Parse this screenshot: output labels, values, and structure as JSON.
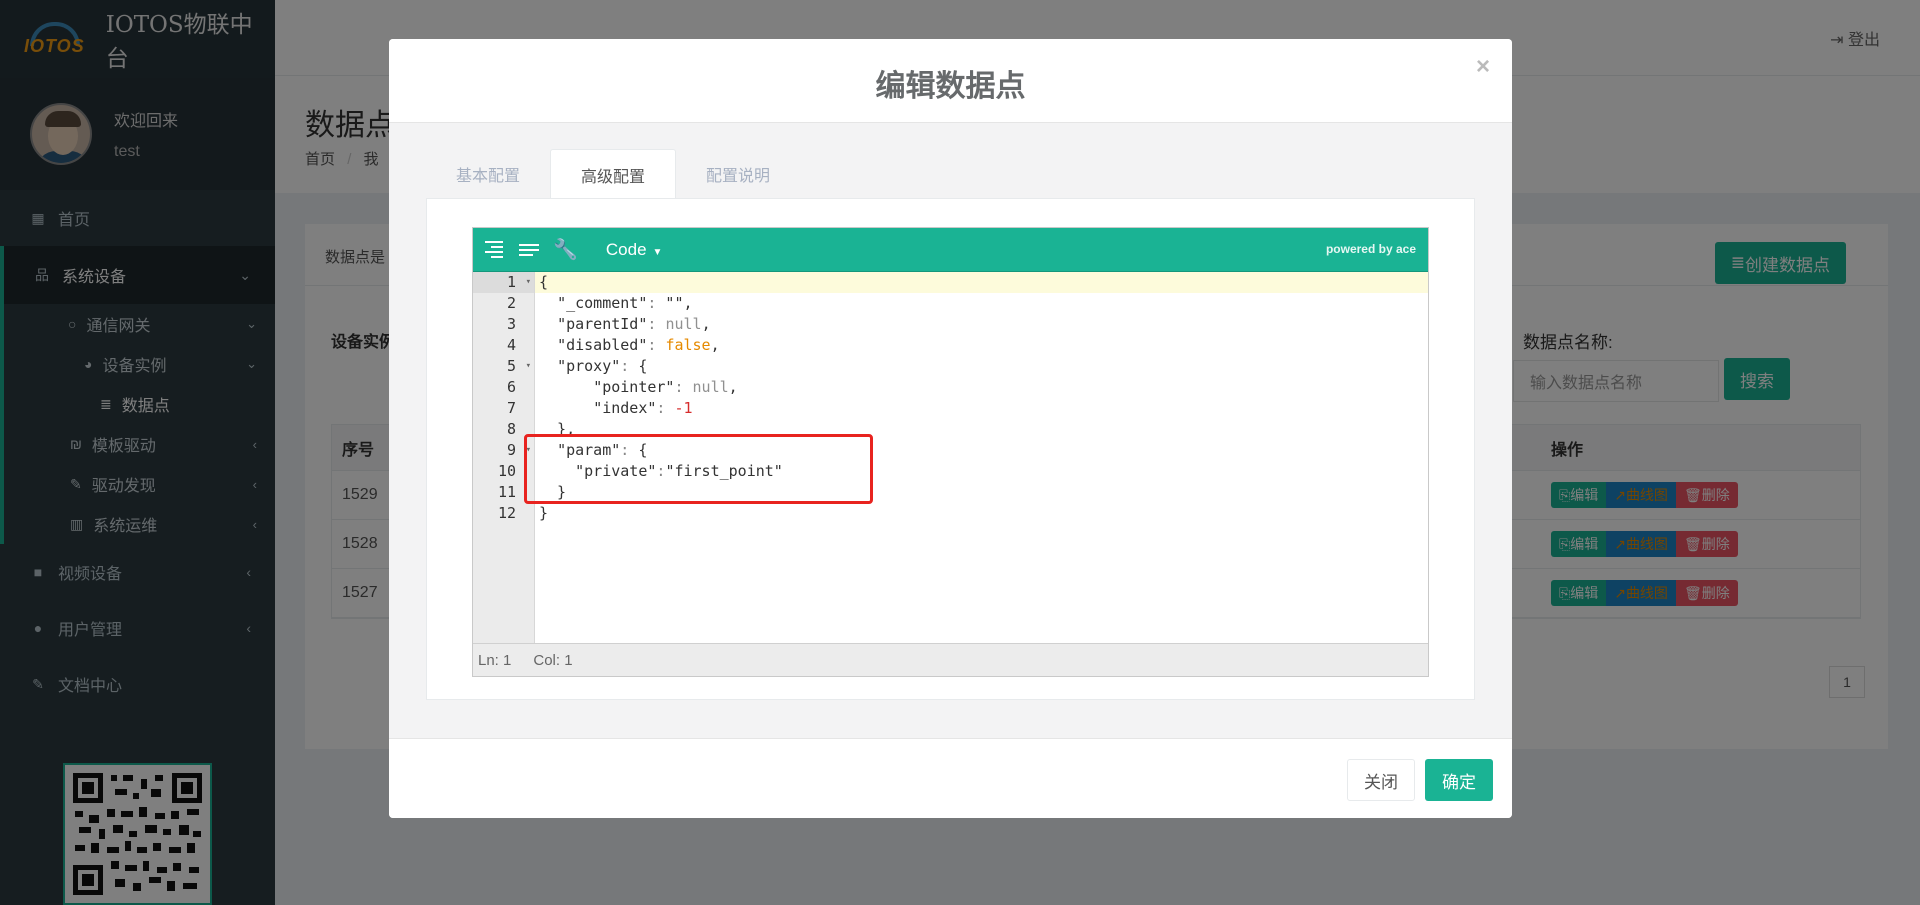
{
  "brand": {
    "logo_text": "IOTOS",
    "title": "IOTOS物联中台"
  },
  "user": {
    "welcome": "欢迎回来",
    "name": "test"
  },
  "sidebar": {
    "home": "首页",
    "system_devices": "系统设备",
    "gateway": "通信网关",
    "device_instance": "设备实例",
    "data_point": "数据点",
    "template_driver": "模板驱动",
    "driver_discovery": "驱动发现",
    "ops": "系统运维",
    "video": "视频设备",
    "user_mgmt": "用户管理",
    "docs": "文档中心"
  },
  "topbar": {
    "logout": "登出"
  },
  "page": {
    "title": "数据点",
    "breadcrumb_home": "首页",
    "breadcrumb_sep": "/",
    "breadcrumb_next": "我",
    "panel_desc": "数据点是",
    "create_button": "创建数据点",
    "device_label": "设备实例",
    "filter_label": "数据点名称:",
    "filter_placeholder": "输入数据点名称",
    "search_button": "搜索"
  },
  "table": {
    "col_id": "序号",
    "col_ops": "操作",
    "rows": [
      {
        "id": "1529"
      },
      {
        "id": "1528"
      },
      {
        "id": "1527"
      }
    ],
    "op_edit": "编辑",
    "op_curve": "曲线图",
    "op_delete": "删除",
    "page_number": "1"
  },
  "modal": {
    "title": "编辑数据点",
    "close_glyph": "×",
    "tabs": [
      "基本配置",
      "高级配置",
      "配置说明"
    ],
    "active_tab": "高级配置",
    "close_button": "关闭",
    "ok_button": "确定"
  },
  "editor": {
    "mode": "Code",
    "powered_by": "powered by ace",
    "status_ln": "Ln: 1",
    "status_col": "Col: 1",
    "line_numbers": [
      "1",
      "2",
      "3",
      "4",
      "5",
      "6",
      "7",
      "8",
      "9",
      "10",
      "11",
      "12"
    ],
    "lines": [
      "{",
      "  \"_comment\": \"\",",
      "  \"parentId\": null,",
      "  \"disabled\": false,",
      "  \"proxy\": {",
      "      \"pointer\": null,",
      "      \"index\": -1",
      "  },",
      "  \"param\": {",
      "    \"private\":\"first_point\"",
      "  }",
      "}"
    ]
  },
  "colors": {
    "accent": "#1ab394",
    "sidebar_bg": "#2c3b41",
    "highlight_box": "#e8231f"
  }
}
